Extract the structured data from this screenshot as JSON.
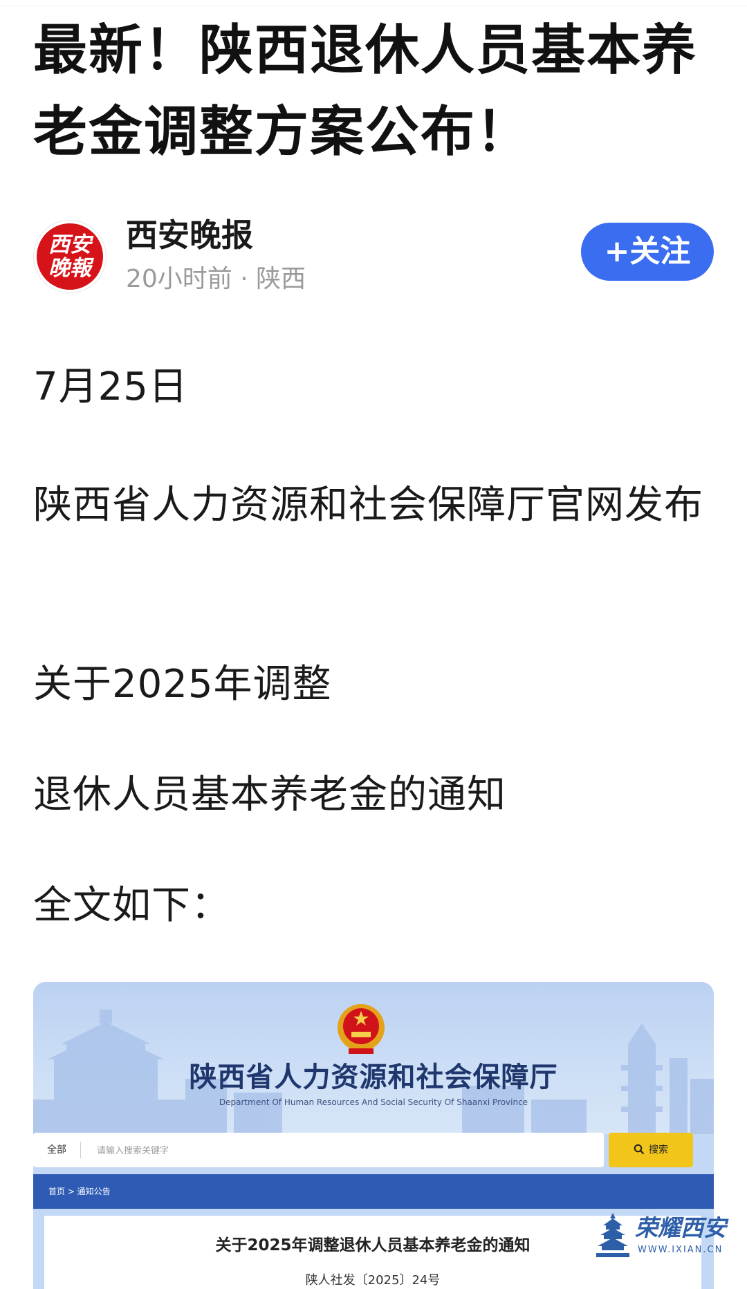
{
  "article": {
    "title": "最新！陕西退休人员基本养老金调整方案公布！",
    "author": {
      "name": "西安晚报",
      "avatar_text": "西安晚報",
      "meta": "20小时前 · 陕西",
      "follow_label": "+关注"
    },
    "paragraphs": [
      "7月25日",
      "陕西省人力资源和社会保障厅官网发布",
      "关于2025年调整",
      "退休人员基本养老金的通知",
      "全文如下："
    ]
  },
  "document_image": {
    "department_name": "陕西省人力资源和社会保障厅",
    "department_english": "Department Of Human Resources And Social Security Of Shaanxi Province",
    "search_scope": "全部",
    "search_placeholder": "请输入搜索关键字",
    "search_button_label": "搜索",
    "breadcrumb": "首页 > 通知公告",
    "notice_title": "关于2025年调整退休人员基本养老金的通知",
    "notice_number": "陕人社发〔2025〕24号"
  },
  "watermark": {
    "name": "荣耀西安",
    "url": "WWW.IXIAN.CN"
  },
  "colors": {
    "follow_button": "#3a6df0",
    "avatar_red": "#d7131a",
    "banner_blue": "#c3d8f4",
    "nav_blue": "#2f5bb4",
    "search_yellow": "#f2c51b",
    "watermark_blue": "#2d5ea8"
  }
}
